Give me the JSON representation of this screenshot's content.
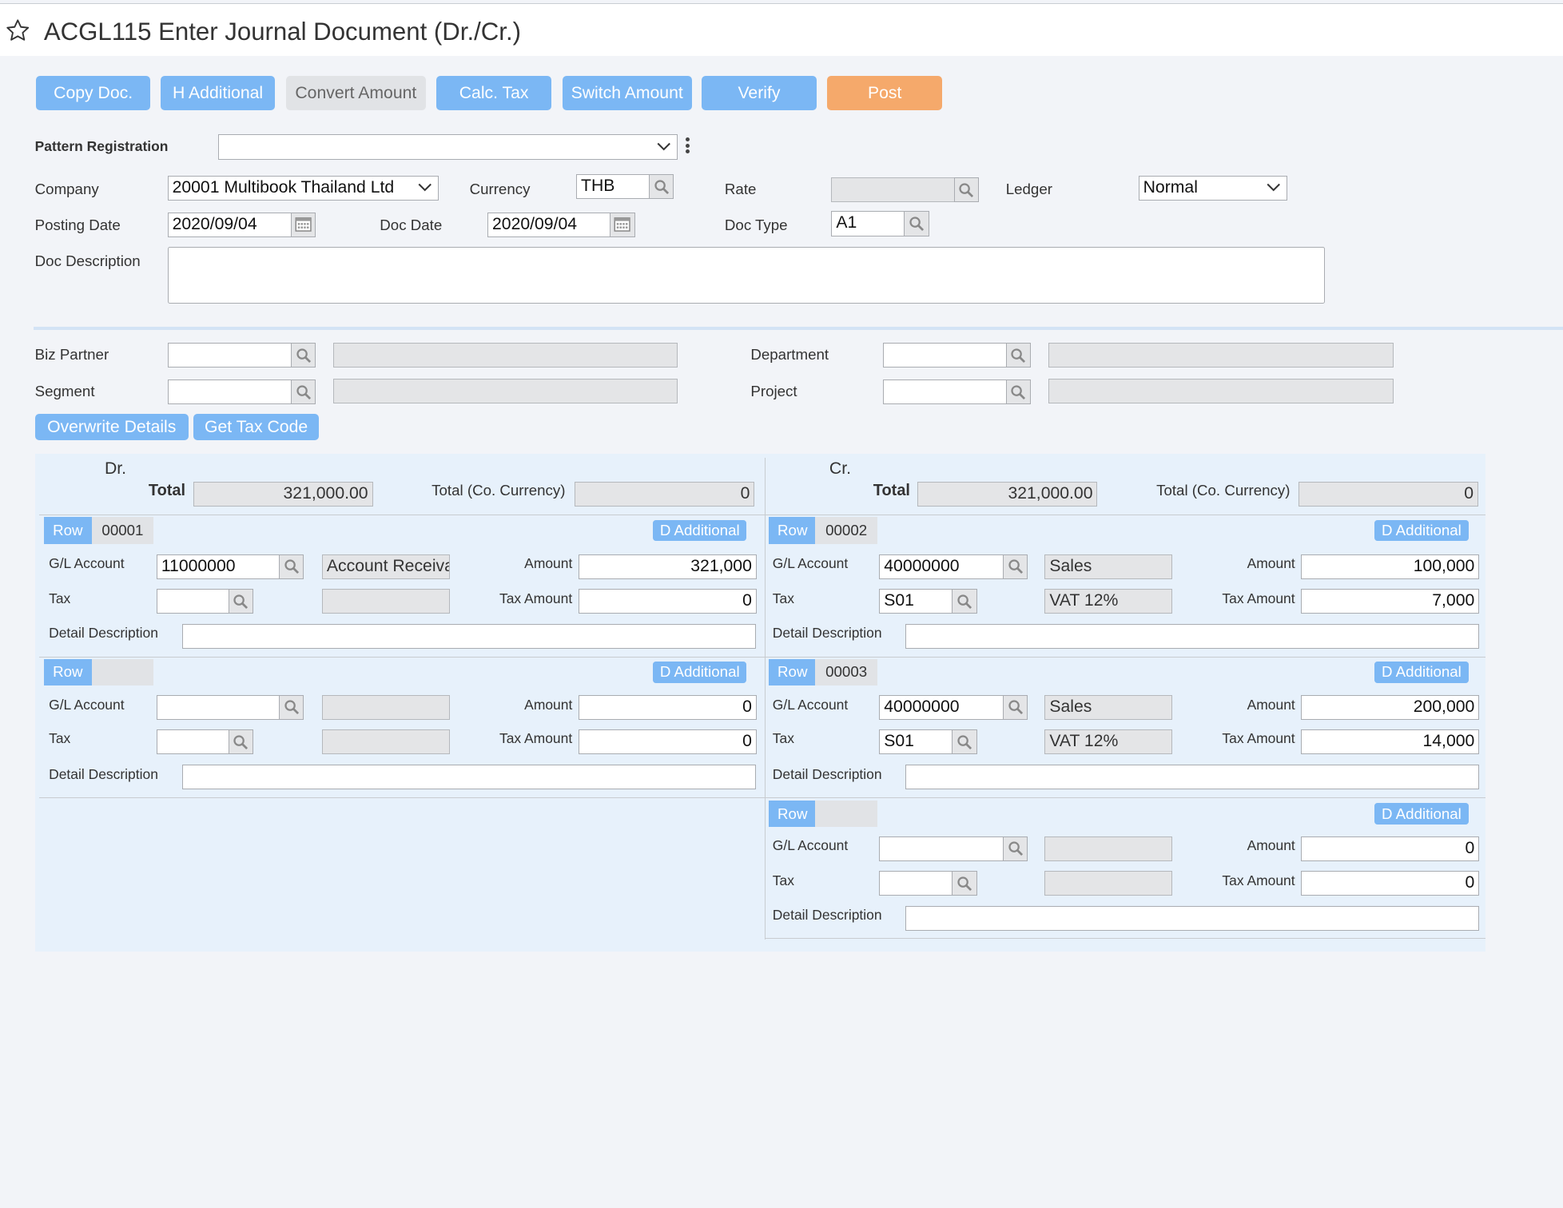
{
  "header": {
    "title": "ACGL115 Enter Journal Document (Dr./Cr.)"
  },
  "toolbar": {
    "copy_doc": "Copy Doc.",
    "h_additional": "H Additional",
    "convert_amount": "Convert Amount",
    "calc_tax": "Calc. Tax",
    "switch_amount": "Switch Amount",
    "verify": "Verify",
    "post": "Post"
  },
  "form": {
    "pattern_registration": {
      "label": "Pattern Registration",
      "value": ""
    },
    "company": {
      "label": "Company",
      "value": "20001 Multibook Thailand Ltd"
    },
    "currency": {
      "label": "Currency",
      "value": "THB"
    },
    "rate": {
      "label": "Rate",
      "value": ""
    },
    "ledger": {
      "label": "Ledger",
      "value": "Normal"
    },
    "posting_date": {
      "label": "Posting Date",
      "value": "2020/09/04"
    },
    "doc_date": {
      "label": "Doc Date",
      "value": "2020/09/04"
    },
    "doc_type": {
      "label": "Doc Type",
      "value": "A1"
    },
    "doc_description": {
      "label": "Doc Description",
      "value": ""
    }
  },
  "partner": {
    "biz_partner": {
      "label": "Biz Partner",
      "value": "",
      "name": ""
    },
    "segment": {
      "label": "Segment",
      "value": "",
      "name": ""
    },
    "department": {
      "label": "Department",
      "value": "",
      "name": ""
    },
    "project": {
      "label": "Project",
      "value": "",
      "name": ""
    },
    "overwrite_details": "Overwrite Details",
    "get_tax_code": "Get Tax Code"
  },
  "labels": {
    "row": "Row",
    "d_additional": "D Additional",
    "gl_account": "G/L Account",
    "tax": "Tax",
    "amount": "Amount",
    "tax_amount": "Tax Amount",
    "detail_description": "Detail Description",
    "total": "Total",
    "total_co_currency": "Total (Co. Currency)"
  },
  "debit": {
    "heading": "Dr.",
    "total": "321,000.00",
    "total_co": "0",
    "rows": [
      {
        "row": "00001",
        "gl_account": "11000000",
        "gl_name": "Account Receivable",
        "tax": "",
        "tax_name": "",
        "amount": "321,000",
        "tax_amount": "0",
        "detail": ""
      },
      {
        "row": "",
        "gl_account": "",
        "gl_name": "",
        "tax": "",
        "tax_name": "",
        "amount": "0",
        "tax_amount": "0",
        "detail": ""
      }
    ]
  },
  "credit": {
    "heading": "Cr.",
    "total": "321,000.00",
    "total_co": "0",
    "rows": [
      {
        "row": "00002",
        "gl_account": "40000000",
        "gl_name": "Sales",
        "tax": "S01",
        "tax_name": "VAT 12%",
        "amount": "100,000",
        "tax_amount": "7,000",
        "detail": ""
      },
      {
        "row": "00003",
        "gl_account": "40000000",
        "gl_name": "Sales",
        "tax": "S01",
        "tax_name": "VAT 12%",
        "amount": "200,000",
        "tax_amount": "14,000",
        "detail": ""
      },
      {
        "row": "",
        "gl_account": "",
        "gl_name": "",
        "tax": "",
        "tax_name": "",
        "amount": "0",
        "tax_amount": "0",
        "detail": ""
      }
    ]
  }
}
